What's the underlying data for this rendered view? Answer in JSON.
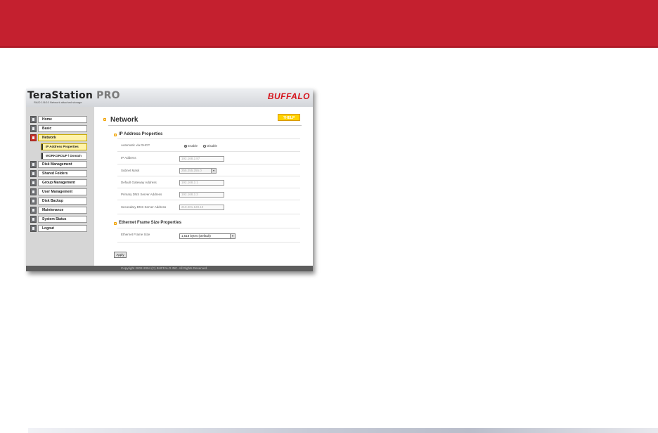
{
  "app": {
    "logo_main": "TeraStation",
    "logo_pro": "PRO",
    "logo_tag": "RAID 1/5/10 Network attached storage",
    "brand": "BUFFALO"
  },
  "sidebar": {
    "items": [
      {
        "label": "Home",
        "icon": "home-icon"
      },
      {
        "label": "Basic",
        "icon": "basic-icon"
      },
      {
        "label": "Network",
        "icon": "network-icon",
        "active": true
      },
      {
        "label": "IP Address Properties",
        "sub": true,
        "active": true
      },
      {
        "label": "WORKGROUP / Domain",
        "sub": true
      },
      {
        "label": "Disk Management",
        "icon": "disk-icon"
      },
      {
        "label": "Shared Folders",
        "icon": "folder-icon"
      },
      {
        "label": "Group Management",
        "icon": "group-icon"
      },
      {
        "label": "User Management",
        "icon": "user-icon"
      },
      {
        "label": "Disk Backup",
        "icon": "backup-icon"
      },
      {
        "label": "Maintenance",
        "icon": "maintenance-icon"
      },
      {
        "label": "System Status",
        "icon": "status-icon"
      },
      {
        "label": "Logout",
        "icon": "logout-icon"
      }
    ]
  },
  "main": {
    "title": "Network",
    "help_label": "?HELP",
    "ip_section": {
      "title": "IP Address Properties",
      "dhcp_label": "Automatic via DHCP",
      "dhcp_enable": "Enable",
      "dhcp_disable": "Disable",
      "ip_label": "IP Address",
      "ip_value": "192.168.2.87",
      "mask_label": "Subnet Mask",
      "mask_value": "255.255.255.0",
      "gateway_label": "Default Gateway Address",
      "gateway_value": "192.168.2.1",
      "dns1_label": "Primary DNS Server Address",
      "dns1_value": "192.168.2.2",
      "dns2_label": "Secondary DNS Server Address",
      "dns2_value": "210.201.128.10"
    },
    "eth_section": {
      "title": "Ethernet Frame Size Properties",
      "frame_label": "Ethernet Frame Size",
      "frame_value": "1,518 bytes (Default)"
    },
    "apply_label": "Apply"
  },
  "footer": {
    "copyright": "Copyright 2002-2004 (C) BUFFALO INC. All Rights Reserved."
  },
  "colors": {
    "banner": "#c4202f",
    "accent_yellow": "#ffd200",
    "brand_red": "#d5141c"
  }
}
